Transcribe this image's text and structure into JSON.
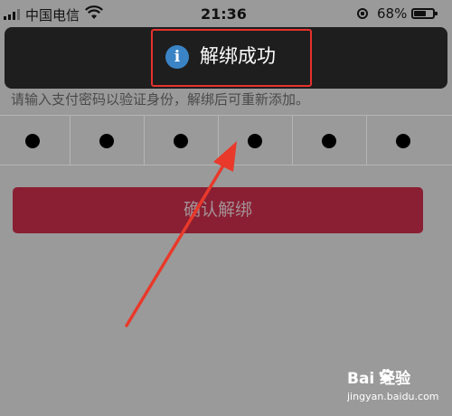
{
  "status_bar": {
    "carrier": "中国电信",
    "time": "21:36",
    "battery_percent": "68%",
    "battery_level": 0.68
  },
  "toast": {
    "message": "解绑成功",
    "icon": "info-icon",
    "highlight_color": "#e5322d"
  },
  "hint_text": "请输入支付密码以验证身份，解绑后可重新添加。",
  "password": {
    "digits_entered": 6
  },
  "confirm_button": {
    "label": "确认解绑",
    "color": "#8a1f33"
  },
  "watermark": {
    "brand": "Bai  经验",
    "url": "jingyan.baidu.com"
  },
  "annotation_arrow_color": "#e8392b"
}
